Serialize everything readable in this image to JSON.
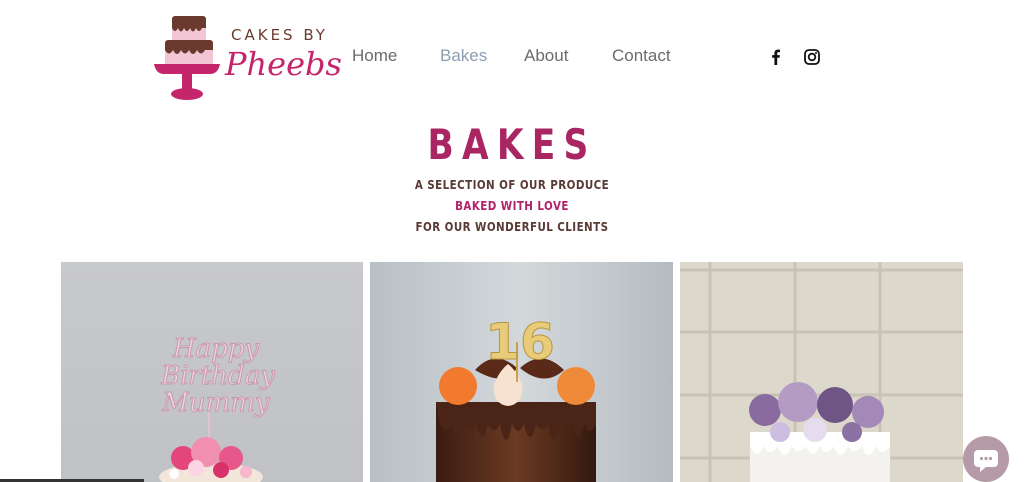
{
  "brand": {
    "line1": "CAKES BY",
    "line2": "Pheebs",
    "colors": {
      "pink": "#c4256b",
      "brown": "#6b3a2e",
      "light_pink": "#f2c9d8"
    }
  },
  "nav": {
    "items": [
      {
        "label": "Home"
      },
      {
        "label": "Bakes",
        "active": true
      },
      {
        "label": "About"
      },
      {
        "label": "Contact"
      }
    ]
  },
  "social": {
    "icons": [
      "facebook-icon",
      "instagram-icon"
    ]
  },
  "hero": {
    "title": "BAKES",
    "line1": "A SELECTION OF OUR PRODUCE",
    "line2": "BAKED WITH LOVE",
    "line3": "FOR OUR WONDERFUL CLIENTS"
  },
  "gallery": {
    "items": [
      {
        "topper": "Happy Birthday Mummy"
      },
      {
        "topper": "16"
      },
      {
        "topper": ""
      }
    ]
  },
  "chat": {
    "icon": "chat-bubble-icon"
  }
}
